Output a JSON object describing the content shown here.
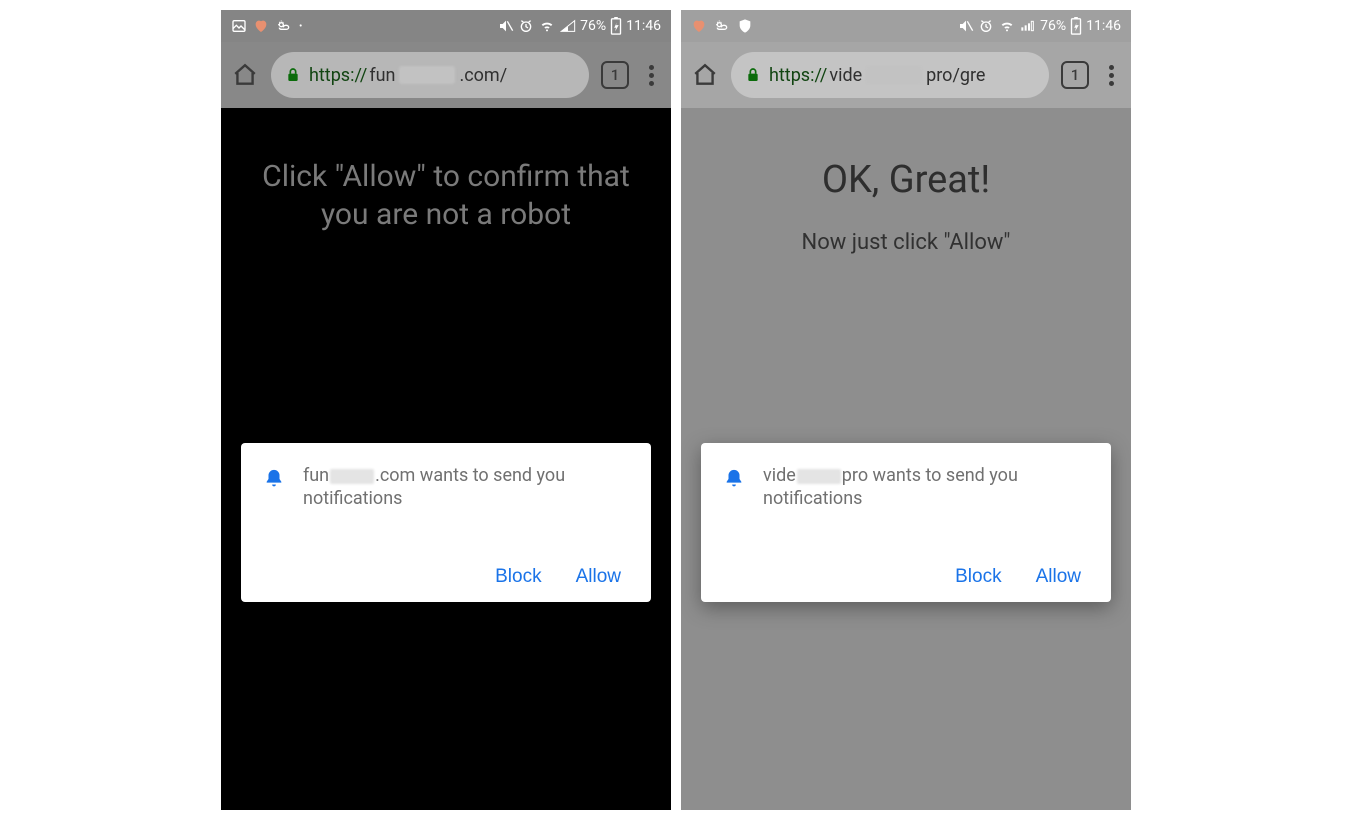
{
  "screens": [
    {
      "status": {
        "battery_percent": "76%",
        "time": "11:46"
      },
      "browser": {
        "url_protocol": "https://",
        "url_prefix": "fun",
        "url_suffix": ".com/",
        "tab_count": "1"
      },
      "page": {
        "headline": "Click \"Allow\" to confirm that you are not a robot"
      },
      "dialog": {
        "msg_prefix": "fun",
        "msg_suffix": ".com wants to send you notifications",
        "block": "Block",
        "allow": "Allow"
      }
    },
    {
      "status": {
        "battery_percent": "76%",
        "time": "11:46"
      },
      "browser": {
        "url_protocol": "https://",
        "url_prefix": "vide",
        "url_suffix": "pro/gre",
        "tab_count": "1"
      },
      "page": {
        "headline": "OK, Great!",
        "subline": "Now just click \"Allow\""
      },
      "dialog": {
        "msg_prefix": "vide",
        "msg_suffix": "pro wants to send you notifications",
        "block": "Block",
        "allow": "Allow"
      }
    }
  ]
}
